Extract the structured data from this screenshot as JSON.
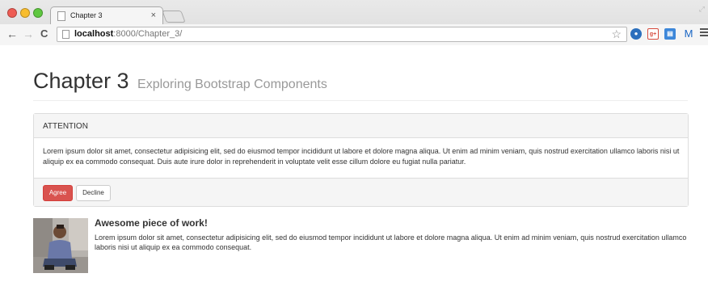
{
  "browser": {
    "tab_title": "Chapter 3",
    "tab_close": "×",
    "url_host": "localhost",
    "url_rest": ":8000/Chapter_3/",
    "star": "☆",
    "ext_gplus": "g+",
    "ext_gmail": "M"
  },
  "page": {
    "title": "Chapter 3",
    "subtitle": "Exploring Bootstrap Components"
  },
  "panel": {
    "heading": "ATTENTION",
    "body": "Lorem ipsum dolor sit amet, consectetur adipisicing elit, sed do eiusmod tempor incididunt ut labore et dolore magna aliqua. Ut enim ad minim veniam, quis nostrud exercitation ullamco laboris nisi ut aliquip ex ea commodo consequat. Duis aute irure dolor in reprehenderit in voluptate velit esse cillum dolore eu fugiat nulla pariatur.",
    "agree_label": "Agree",
    "decline_label": "Decline"
  },
  "media": {
    "heading": "Awesome piece of work!",
    "text": "Lorem ipsum dolor sit amet, consectetur adipisicing elit, sed do eiusmod tempor incididunt ut labore et dolore magna aliqua. Ut enim ad minim veniam, quis nostrud exercitation ullamco laboris nisi ut aliquip ex ea commodo consequat."
  },
  "colors": {
    "danger": "#d9534f",
    "panel_bg": "#f5f5f5",
    "border": "#dddddd",
    "muted": "#999999"
  },
  "icons": [
    "page-icon",
    "back-arrow-icon",
    "forward-arrow-icon",
    "reload-icon",
    "star-icon",
    "person-icon",
    "gplus-icon",
    "news-icon",
    "gmail-icon",
    "menu-icon"
  ]
}
